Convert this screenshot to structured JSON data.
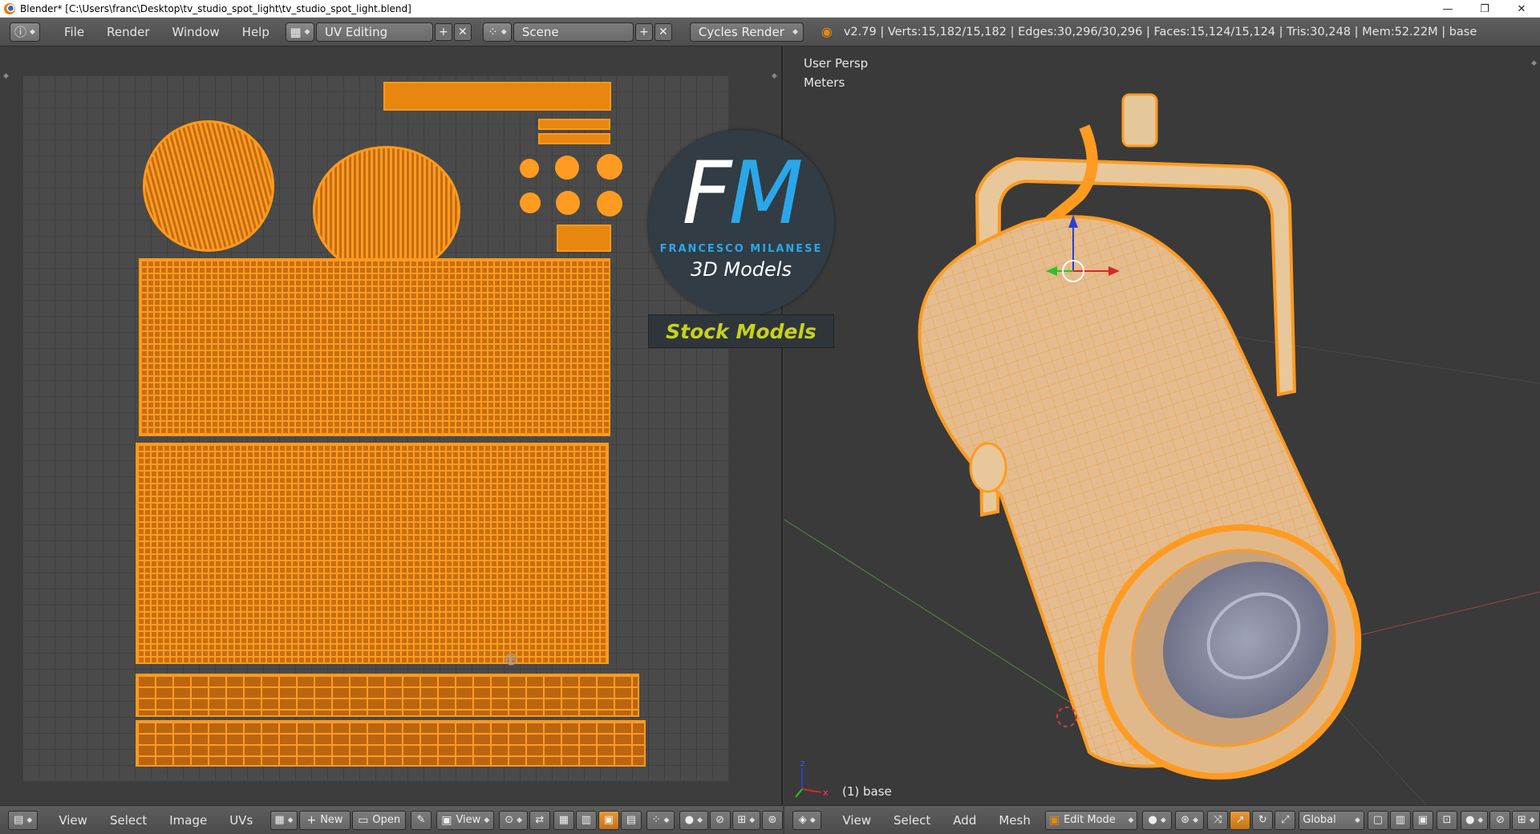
{
  "window": {
    "title": "Blender* [C:\\Users\\franc\\Desktop\\tv_studio_spot_light\\tv_studio_spot_light.blend]",
    "controls": [
      "—",
      "❐",
      "✕"
    ]
  },
  "topbar": {
    "menus": [
      "File",
      "Render",
      "Window",
      "Help"
    ],
    "layout": "UV Editing",
    "scene": "Scene",
    "engine": "Cycles Render",
    "stats": "v2.79 | Verts:15,182/15,182 | Edges:30,296/30,296 | Faces:15,124/15,124 | Tris:30,248 | Mem:52.22M | base"
  },
  "viewport": {
    "view_name": "User Persp",
    "units": "Meters",
    "object_label": "(1) base",
    "axis_x": "x",
    "axis_z": "z"
  },
  "logo": {
    "f": "F",
    "m": "M",
    "brand": "FRANCESCO MILANESE",
    "subtitle": "3D Models",
    "stock": "Stock Models"
  },
  "uv_toolbar": {
    "menus": [
      "View",
      "Select",
      "Image",
      "UVs"
    ],
    "new_label": "New",
    "open_label": "Open",
    "view_label": "View"
  },
  "view3d_toolbar": {
    "menus": [
      "View",
      "Select",
      "Add",
      "Mesh"
    ],
    "mode": "Edit Mode",
    "orientation": "Global"
  },
  "colors": {
    "selection": "#ff9b20",
    "background": "#3d3d3d",
    "logo_blue": "#2aa7e8",
    "stock_yellow": "#c8d21a"
  }
}
